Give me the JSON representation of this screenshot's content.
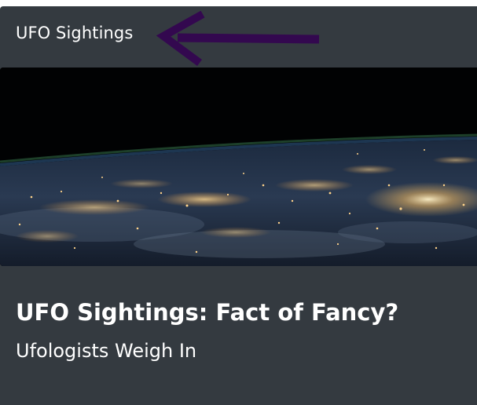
{
  "navbar": {
    "title": "UFO Sightings",
    "annotation_icon": "arrow-left-icon",
    "annotation_color": "#33084f"
  },
  "hero": {
    "image_icon": "earth-night-image"
  },
  "article": {
    "headline": "UFO Sightings: Fact of Fancy?",
    "subheadline": "Ufologists Weigh In"
  },
  "colors": {
    "panel_background": "#343a40",
    "text": "#ffffff"
  }
}
